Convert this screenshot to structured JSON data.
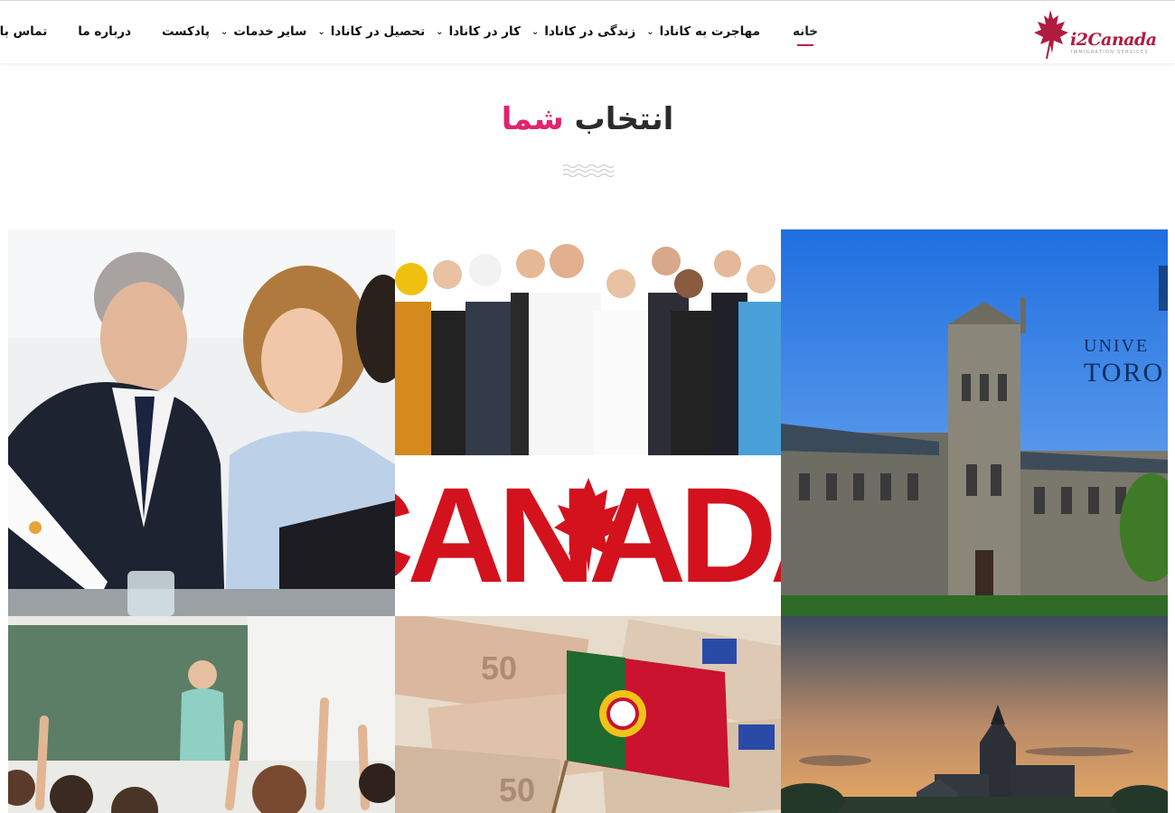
{
  "site": {
    "logo_text": "i2Canada",
    "logo_sub": "IMMIGRATION SERVICES",
    "brand_color": "#b01c40",
    "accent_color": "#e0246f"
  },
  "nav": {
    "items": [
      {
        "label": "خانه",
        "active": true,
        "has_dropdown": false
      },
      {
        "label": "مهاجرت به کانادا",
        "active": false,
        "has_dropdown": true
      },
      {
        "label": "زندگی در کانادا",
        "active": false,
        "has_dropdown": true
      },
      {
        "label": "کار در کانادا",
        "active": false,
        "has_dropdown": true
      },
      {
        "label": "تحصیل در کانادا",
        "active": false,
        "has_dropdown": true
      },
      {
        "label": "سایر خدمات",
        "active": false,
        "has_dropdown": true
      },
      {
        "label": "پادکست",
        "active": false,
        "has_dropdown": false
      },
      {
        "label": "درباره ما",
        "active": false,
        "has_dropdown": false
      },
      {
        "label": "تماس با ما",
        "active": false,
        "has_dropdown": false
      }
    ]
  },
  "section": {
    "title_word1": "انتخاب",
    "title_word2": "شما"
  },
  "tiles": {
    "business": {
      "icon": "business-meeting-image"
    },
    "workers": {
      "icon": "canada-workers-image",
      "overlay_text": "CANADA"
    },
    "university": {
      "icon": "university-of-toronto-image",
      "overlay_text": "UNIVERSITY OF TORONTO"
    },
    "classroom": {
      "icon": "classroom-image"
    },
    "portugal": {
      "icon": "portugal-flag-euros-image"
    },
    "quebec": {
      "icon": "quebec-city-image"
    }
  }
}
